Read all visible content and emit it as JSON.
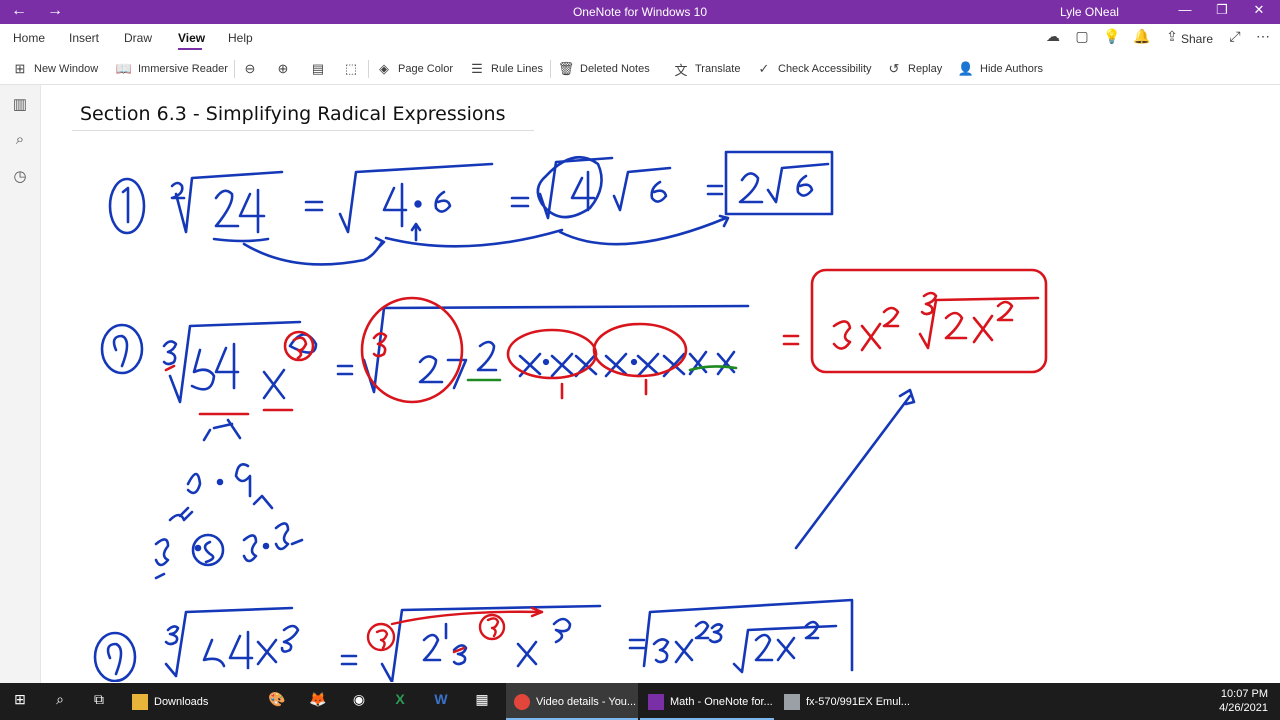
{
  "titlebar": {
    "title": "OneNote for Windows 10",
    "user": "Lyle ONeal"
  },
  "menu": {
    "tabs": [
      "Home",
      "Insert",
      "Draw",
      "View",
      "Help"
    ],
    "active": "View"
  },
  "share_label": "Share",
  "ribbon": {
    "new_window": "New Window",
    "immersive_reader": "Immersive Reader",
    "page_color": "Page Color",
    "rule_lines": "Rule Lines",
    "deleted_notes": "Deleted Notes",
    "translate": "Translate",
    "check_accessibility": "Check Accessibility",
    "replay": "Replay",
    "hide_authors": "Hide Authors"
  },
  "page": {
    "title": "Section 6.3 - Simplifying Radical Expressions"
  },
  "taskbar": {
    "downloads": "Downloads",
    "chrome": "Video details - You...",
    "onenote": "Math - OneNote for...",
    "emulator": "fx-570/991EX Emul...",
    "time": "10:07 PM",
    "date": "4/26/2021"
  },
  "colors": {
    "titlebar": "#7b2fa6",
    "ink_blue": "#1538b8",
    "ink_red": "#d8141c",
    "ink_green": "#1f8a22",
    "taskbar": "#1c1c1c"
  }
}
